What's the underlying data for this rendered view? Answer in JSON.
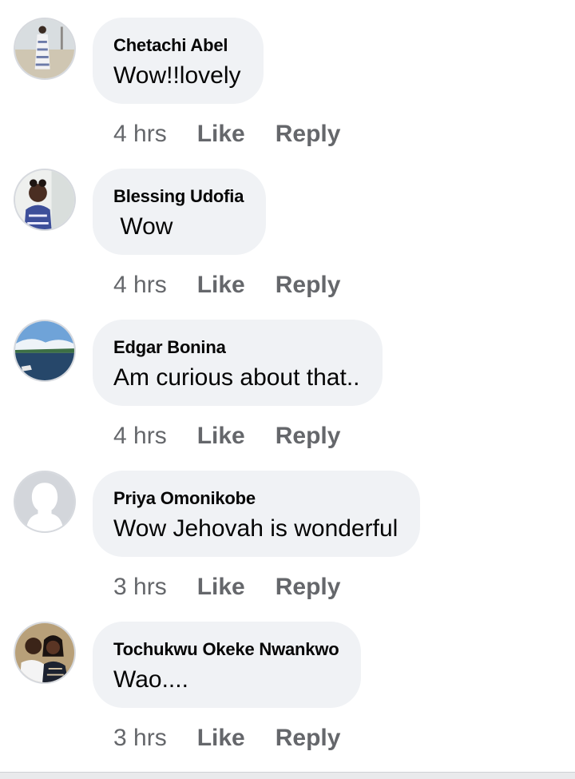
{
  "comments": [
    {
      "author": "Chetachi Abel",
      "text": "Wow!!lovely",
      "time": "4 hrs",
      "like": "Like",
      "reply": "Reply"
    },
    {
      "author": "Blessing Udofia",
      "text": " Wow",
      "time": "4 hrs",
      "like": "Like",
      "reply": "Reply"
    },
    {
      "author": "Edgar Bonina",
      "text": "Am curious about that..",
      "time": "4 hrs",
      "like": "Like",
      "reply": "Reply"
    },
    {
      "author": "Priya Omonikobe",
      "text": "Wow Jehovah is wonderful",
      "time": "3 hrs",
      "like": "Like",
      "reply": "Reply"
    },
    {
      "author": "Tochukwu Okeke Nwankwo",
      "text": "Wao....",
      "time": "3 hrs",
      "like": "Like",
      "reply": "Reply"
    }
  ],
  "colors": {
    "bubble": "#f0f2f5",
    "text": "#050505",
    "meta": "#65676b"
  }
}
